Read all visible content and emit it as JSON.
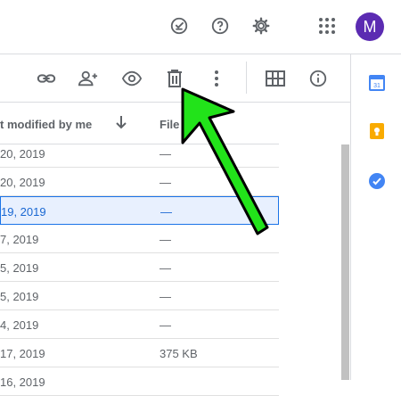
{
  "account": {
    "initial": "M"
  },
  "table": {
    "col_modified": "t modified by me",
    "col_file": "File",
    "rows": [
      {
        "date": "20, 2019",
        "size": "—"
      },
      {
        "date": "20, 2019",
        "size": "—"
      },
      {
        "date": "19, 2019",
        "size": "—"
      },
      {
        "date": "7, 2019",
        "size": "—"
      },
      {
        "date": "5, 2019",
        "size": "—"
      },
      {
        "date": "5, 2019",
        "size": "—"
      },
      {
        "date": "4, 2019",
        "size": "—"
      },
      {
        "date": "17, 2019",
        "size": "375 KB"
      },
      {
        "date": "16, 2019",
        "size": ""
      }
    ]
  },
  "icons": {
    "topbar": [
      "offline-check-icon",
      "help-icon",
      "settings-gear-icon",
      "apps-grid-icon"
    ],
    "toolbar": [
      "link-icon",
      "add-person-icon",
      "preview-eye-icon",
      "trash-icon",
      "more-vert-icon",
      "grid-view-icon",
      "info-icon"
    ],
    "side": [
      "calendar-icon",
      "keep-icon",
      "tasks-icon"
    ]
  },
  "colors": {
    "accent": "#1a73e8",
    "selection": "#e8f0fe",
    "avatar": "#5b2bb2",
    "annotation": "#22e31a"
  }
}
